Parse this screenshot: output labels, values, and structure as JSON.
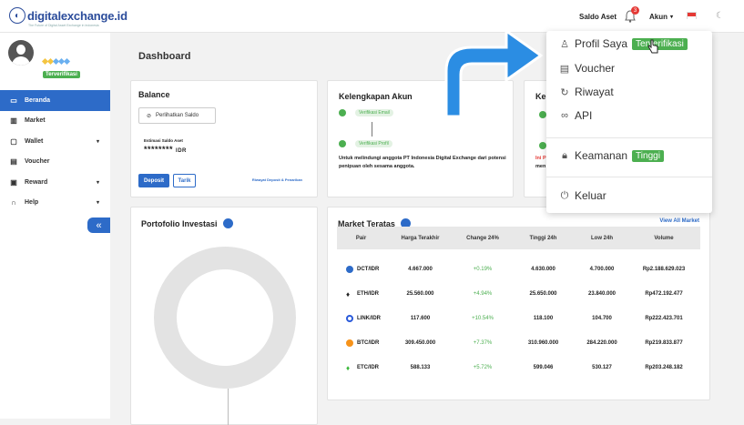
{
  "brand": {
    "name": "digitalexchange.id",
    "tagline": "The Future of Digital Asset Exchange in Indonesia"
  },
  "header": {
    "saldo_aset": "Saldo Aset",
    "notif_count": "3",
    "account": "Akun"
  },
  "sidebar": {
    "verified": "Terverifikasi",
    "items": [
      {
        "label": "Beranda",
        "icon": "monitor-icon"
      },
      {
        "label": "Market",
        "icon": "chart-icon"
      },
      {
        "label": "Wallet",
        "icon": "wallet-icon"
      },
      {
        "label": "Voucher",
        "icon": "voucher-icon"
      },
      {
        "label": "Reward",
        "icon": "gift-icon"
      },
      {
        "label": "Help",
        "icon": "headset-icon"
      }
    ]
  },
  "page": {
    "title": "Dashboard"
  },
  "balance": {
    "title": "Balance",
    "show": "Perlihatkan Saldo",
    "estimate_label": "Estimasi Saldo Aset",
    "hidden_value": "********",
    "currency": "IDR",
    "deposit": "Deposit",
    "withdraw": "Tarik",
    "history": "Riwayat Deposit & Penarikan"
  },
  "kelengkapan": {
    "title": "Kelengkapan Akun",
    "step1": "Verifikasi Email",
    "step2": "Verifikasi Profil",
    "desc": "Untuk melindungi anggota PT Indonesia Digital Exchange dari potensi penipuan oleh sesama anggota."
  },
  "partial": {
    "title": "Kel",
    "line1": "Ini P",
    "line2": "men"
  },
  "portfolio": {
    "title": "Portofolio Investasi"
  },
  "market": {
    "title": "Market Teratas",
    "view_all": "View All Market",
    "columns": [
      "Pair",
      "Harga Terakhir",
      "Change 24%",
      "Tinggi 24h",
      "Low 24h",
      "Volume"
    ],
    "rows": [
      {
        "pair": "DCT/IDR",
        "price": "4.667.000",
        "change": "+0.19%",
        "high": "4.630.000",
        "low": "4.700.000",
        "volume": "Rp2.188.629.023"
      },
      {
        "pair": "ETH/IDR",
        "price": "25.560.000",
        "change": "+4.94%",
        "high": "25.650.000",
        "low": "23.840.000",
        "volume": "Rp472.192.477"
      },
      {
        "pair": "LINK/IDR",
        "price": "117.600",
        "change": "+10.54%",
        "high": "118.100",
        "low": "104.700",
        "volume": "Rp222.423.701"
      },
      {
        "pair": "BTC/IDR",
        "price": "309.450.000",
        "change": "+7.37%",
        "high": "310.960.000",
        "low": "284.220.000",
        "volume": "Rp219.833.877"
      },
      {
        "pair": "ETC/IDR",
        "price": "588.133",
        "change": "+5.72%",
        "high": "599.046",
        "low": "530.127",
        "volume": "Rp203.248.182"
      }
    ]
  },
  "dropdown": {
    "profile": "Profil Saya",
    "profile_tag": "Terverifikasi",
    "voucher": "Voucher",
    "history": "Riwayat",
    "api": "API",
    "security": "Keamanan",
    "security_tag": "Tinggi",
    "logout": "Keluar"
  },
  "colors": {
    "primary": "#2d6bc8",
    "success": "#4caf50",
    "arrow": "#2b8de3"
  }
}
